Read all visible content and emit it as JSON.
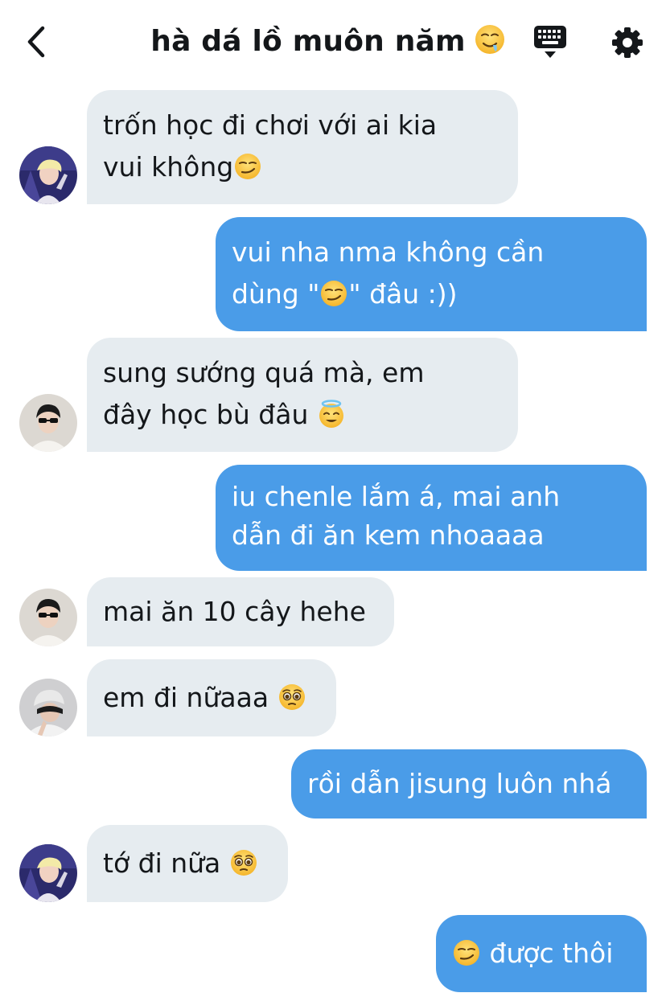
{
  "header": {
    "title": "hà dá lồ muôn năm",
    "title_emoji": "drooling-face-emoji",
    "icons": [
      "chevron-left-icon",
      "keyboard-icon",
      "gear-icon"
    ]
  },
  "colors": {
    "incoming_bubble": "#e6ecf0",
    "outgoing_bubble": "#4a9ce8",
    "text": "#14171a"
  },
  "messages": [
    {
      "from": "them",
      "avatar": "avatar-blonde",
      "lines": [
        "trốn học đi chơi với ai kia",
        "vui không"
      ],
      "emoji": "smirk-emoji"
    },
    {
      "from": "me",
      "line1": "vui nha nma không cần",
      "line2a": "dùng \"",
      "line2b": "\" đâu :))",
      "emoji": "smirk-emoji"
    },
    {
      "from": "them",
      "avatar": "avatar-sunglasses",
      "lines": [
        "sung sướng quá mà, em",
        "đây học bù đâu"
      ],
      "emoji": "smiling-halo-emoji"
    },
    {
      "from": "me",
      "lines": [
        "iu chenle lắm á, mai anh",
        "dẫn đi ăn kem nhoaaaa"
      ]
    },
    {
      "from": "them",
      "avatar": "avatar-sunglasses",
      "text": "mai ăn 10 cây hehe"
    },
    {
      "from": "them",
      "avatar": "avatar-cap",
      "text": "em đi nữaaa",
      "emoji": "pleading-face-emoji"
    },
    {
      "from": "me",
      "text": "rồi dẫn jisung luôn nhá"
    },
    {
      "from": "them",
      "avatar": "avatar-blonde",
      "text": "tớ đi nữa",
      "emoji": "pleading-face-emoji"
    },
    {
      "from": "me",
      "text": "được thôi",
      "emoji": "smirk-emoji"
    }
  ]
}
